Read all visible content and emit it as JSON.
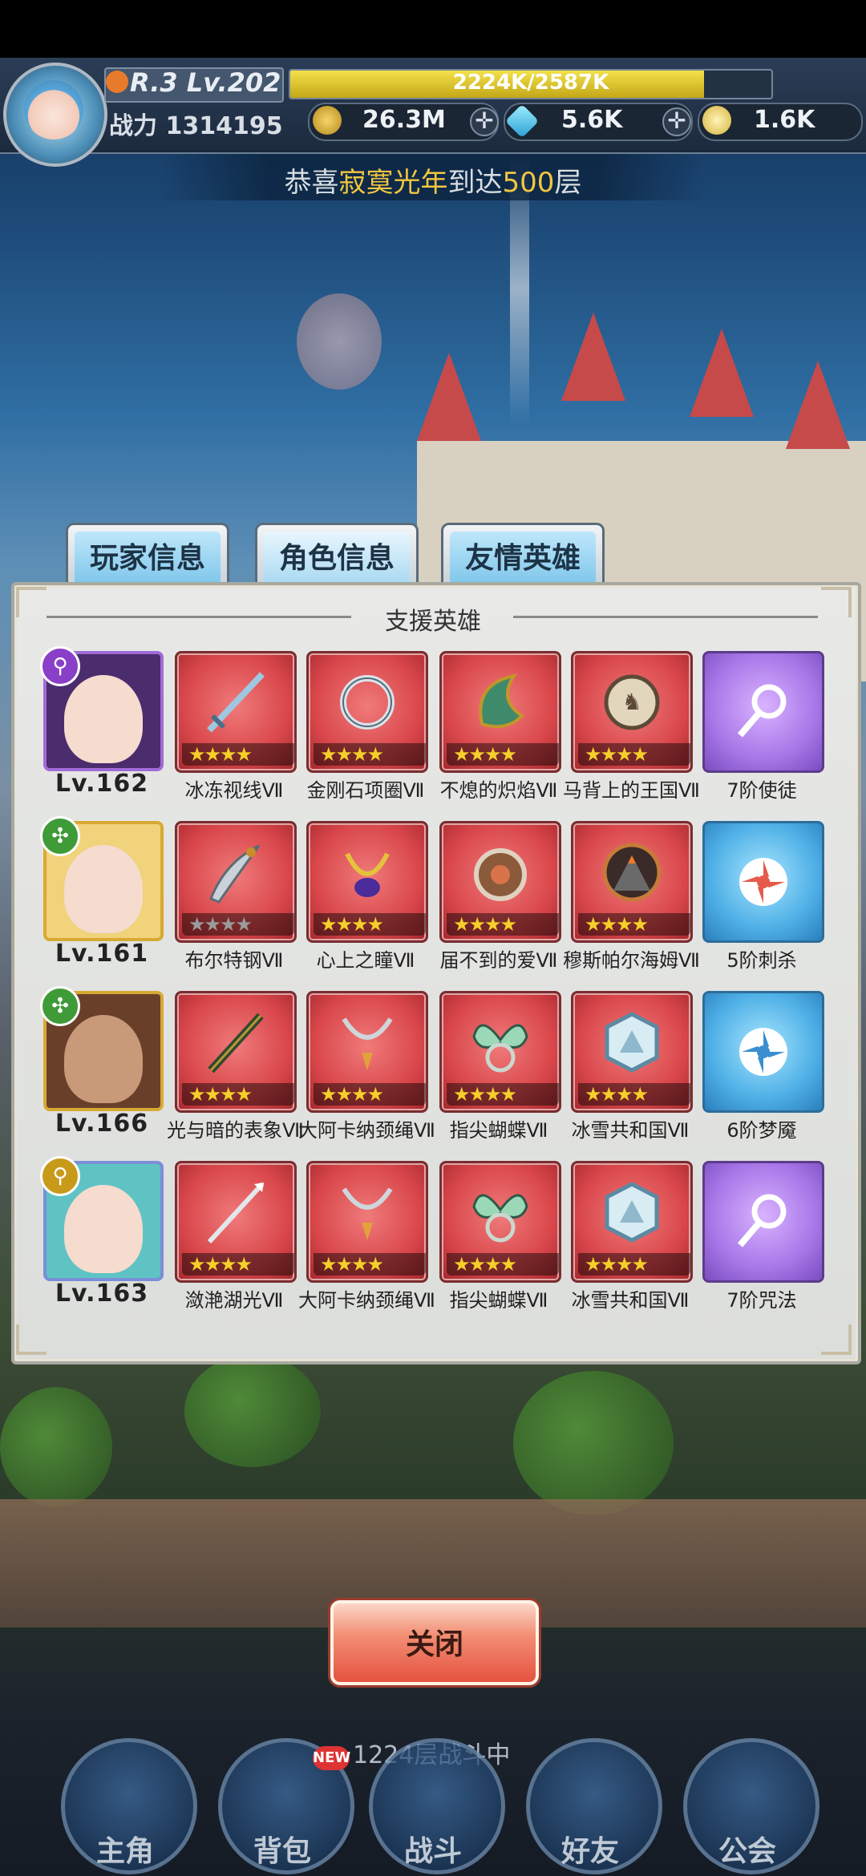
{
  "hud": {
    "rank": "R.3 Lv.202",
    "exp_text": "2224K/2587K",
    "exp_fraction": 0.86,
    "power_label": "战力 1314195",
    "gold": "26.3M",
    "diamond": "5.6K",
    "stamina": "1.6K",
    "plus": "✛"
  },
  "notice": {
    "prefix": "恭喜",
    "name": "寂寞光年",
    "middle": "到达",
    "floor": "500",
    "suffix": "层"
  },
  "tabs": [
    "玩家信息",
    "角色信息",
    "友情英雄"
  ],
  "section_title": "支援英雄",
  "heroes": [
    {
      "level": "Lv.162",
      "items": [
        {
          "label": "冰冻视线Ⅶ",
          "stars": "★★★★"
        },
        {
          "label": "金刚石项圈Ⅶ",
          "stars": "★★★★"
        },
        {
          "label": "不熄的炽焰Ⅶ",
          "stars": "★★★★"
        },
        {
          "label": "马背上的王国Ⅶ",
          "stars": "★★★★"
        }
      ],
      "skill": "7阶使徒"
    },
    {
      "level": "Lv.161",
      "items": [
        {
          "label": "布尔特钢Ⅶ",
          "stars": "★★★★"
        },
        {
          "label": "心上之瞳Ⅶ",
          "stars": "★★★★"
        },
        {
          "label": "届不到的爱Ⅶ",
          "stars": "★★★★"
        },
        {
          "label": "穆斯帕尔海姆Ⅶ",
          "stars": "★★★★"
        }
      ],
      "skill": "5阶刺杀"
    },
    {
      "level": "Lv.166",
      "items": [
        {
          "label": "光与暗的表象Ⅶ",
          "stars": "★★★★"
        },
        {
          "label": "大阿卡纳颈绳Ⅶ",
          "stars": "★★★★"
        },
        {
          "label": "指尖蝴蝶Ⅶ",
          "stars": "★★★★"
        },
        {
          "label": "冰雪共和国Ⅶ",
          "stars": "★★★★"
        }
      ],
      "skill": "6阶梦魇"
    },
    {
      "level": "Lv.163",
      "items": [
        {
          "label": "潋滟湖光Ⅶ",
          "stars": "★★★★"
        },
        {
          "label": "大阿卡纳颈绳Ⅶ",
          "stars": "★★★★"
        },
        {
          "label": "指尖蝴蝶Ⅶ",
          "stars": "★★★★"
        },
        {
          "label": "冰雪共和国Ⅶ",
          "stars": "★★★★"
        }
      ],
      "skill": "7阶咒法"
    }
  ],
  "close_button": "关闭",
  "battle_floor": "1224层战斗中",
  "new_badge": "NEW",
  "nav": [
    "主角",
    "背包",
    "战斗",
    "好友",
    "公会"
  ]
}
